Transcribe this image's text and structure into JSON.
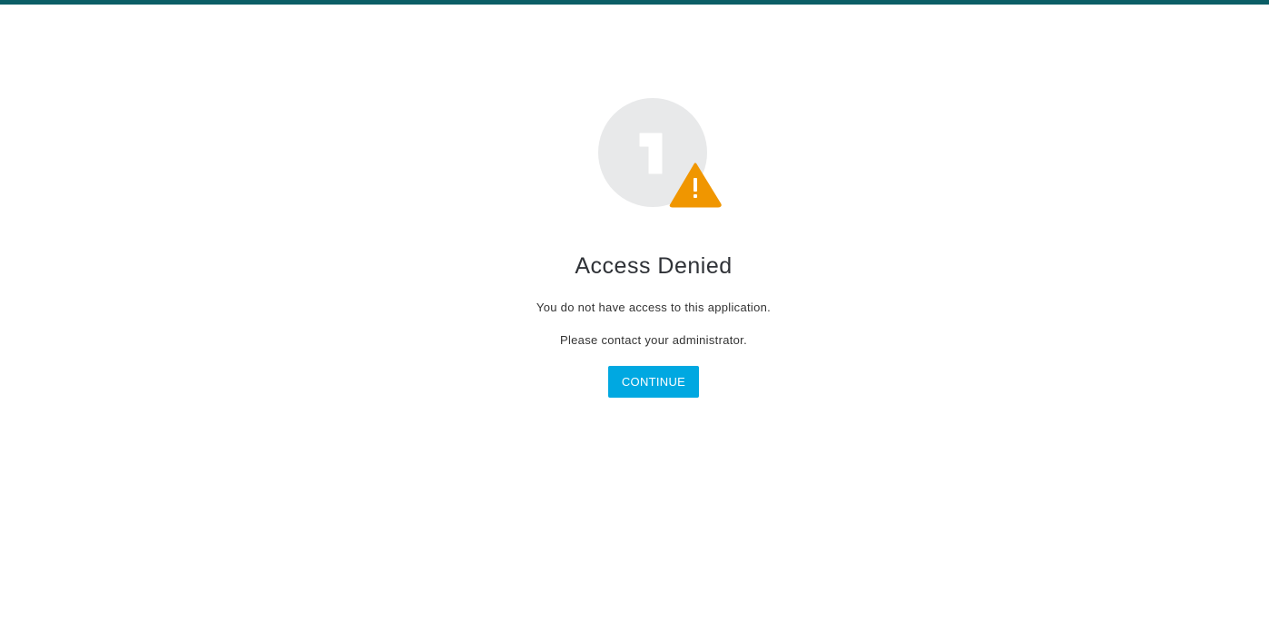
{
  "page": {
    "title": "Access Denied",
    "message": "You do not have access to this application.",
    "instruction": "Please contact your administrator.",
    "continue_label": "CONTINUE"
  },
  "icons": {
    "app": "app-logo-icon",
    "warning": "warning-icon"
  },
  "colors": {
    "top_bar": "#0b5e66",
    "button": "#00a8e1",
    "warning": "#f09600",
    "circle": "#e8e9ea"
  }
}
